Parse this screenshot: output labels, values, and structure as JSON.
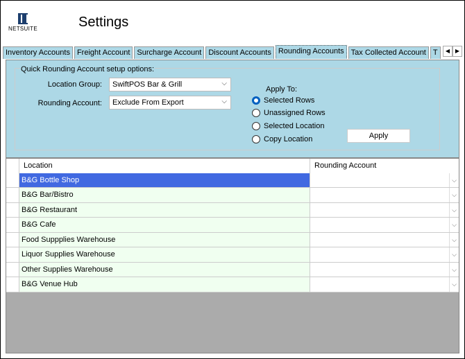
{
  "header": {
    "logo_text": "NETSUITE",
    "title": "Settings"
  },
  "tabs": [
    {
      "label": "Inventory Accounts"
    },
    {
      "label": "Freight Account"
    },
    {
      "label": "Surcharge  Account"
    },
    {
      "label": "Discount Accounts"
    },
    {
      "label": "Rounding Accounts",
      "active": true
    },
    {
      "label": "Tax Collected Account"
    },
    {
      "label": "T"
    }
  ],
  "options": {
    "group_label": "Quick Rounding Account setup options:",
    "location_group_label": "Location Group:",
    "location_group_value": "SwiftPOS Bar & Grill",
    "rounding_account_label": "Rounding Account:",
    "rounding_account_value": "Exclude From Export",
    "apply_to_label": "Apply To:",
    "radios": [
      {
        "label": "Selected Rows",
        "checked": true
      },
      {
        "label": "Unassigned Rows",
        "checked": false
      },
      {
        "label": "Selected Location",
        "checked": false
      },
      {
        "label": "Copy Location",
        "checked": false
      }
    ],
    "apply_label": "Apply"
  },
  "grid": {
    "columns": [
      "Location",
      "Rounding Account"
    ],
    "rows": [
      {
        "location": "B&G Bottle Shop",
        "account": "",
        "selected": true
      },
      {
        "location": "B&G Bar/Bistro",
        "account": ""
      },
      {
        "location": "B&G Restaurant",
        "account": ""
      },
      {
        "location": "B&G Cafe",
        "account": ""
      },
      {
        "location": "Food Suppplies Warehouse",
        "account": ""
      },
      {
        "location": "Liquor Supplies Warehouse",
        "account": ""
      },
      {
        "location": "Other Supplies Warehouse",
        "account": ""
      },
      {
        "location": "B&G Venue Hub",
        "account": ""
      }
    ]
  },
  "colors": {
    "panel": "#add8e6",
    "selection": "#4169e1",
    "radio_accent": "#0060c0"
  }
}
